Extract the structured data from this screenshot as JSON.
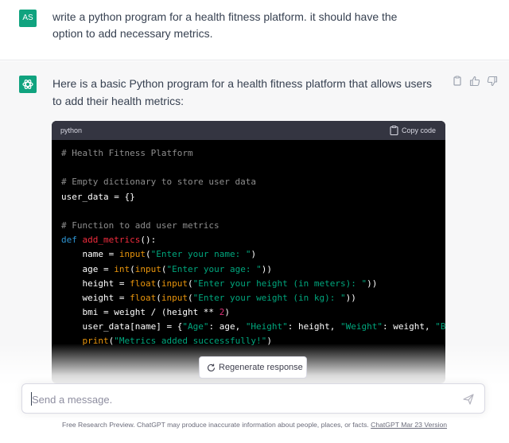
{
  "user_message": {
    "avatar_initials": "AS",
    "text": "write a python program for a health fitness platform. it should have the option to add necessary metrics."
  },
  "assistant_message": {
    "avatar_icon": "openai-logo-icon",
    "text": "Here is a basic Python program for a health fitness platform that allows users to add their health metrics:",
    "actions": [
      "copy-icon",
      "thumbs-up-icon",
      "thumbs-down-icon"
    ]
  },
  "code_block": {
    "language": "python",
    "copy_label": "Copy code",
    "lines": [
      [
        [
          "comment",
          "# Health Fitness Platform"
        ]
      ],
      [],
      [
        [
          "comment",
          "# Empty dictionary to store user data"
        ]
      ],
      [
        [
          "plain",
          "user_data = {}"
        ]
      ],
      [],
      [
        [
          "comment",
          "# Function to add user metrics"
        ]
      ],
      [
        [
          "keyword",
          "def "
        ],
        [
          "func",
          "add_metrics"
        ],
        [
          "plain",
          "():"
        ]
      ],
      [
        [
          "plain",
          "    name = "
        ],
        [
          "builtin",
          "input"
        ],
        [
          "plain",
          "("
        ],
        [
          "string",
          "\"Enter your name: \""
        ],
        [
          "plain",
          ")"
        ]
      ],
      [
        [
          "plain",
          "    age = "
        ],
        [
          "builtin",
          "int"
        ],
        [
          "plain",
          "("
        ],
        [
          "builtin",
          "input"
        ],
        [
          "plain",
          "("
        ],
        [
          "string",
          "\"Enter your age: \""
        ],
        [
          "plain",
          "))"
        ]
      ],
      [
        [
          "plain",
          "    height = "
        ],
        [
          "builtin",
          "float"
        ],
        [
          "plain",
          "("
        ],
        [
          "builtin",
          "input"
        ],
        [
          "plain",
          "("
        ],
        [
          "string",
          "\"Enter your height (in meters): \""
        ],
        [
          "plain",
          "))"
        ]
      ],
      [
        [
          "plain",
          "    weight = "
        ],
        [
          "builtin",
          "float"
        ],
        [
          "plain",
          "("
        ],
        [
          "builtin",
          "input"
        ],
        [
          "plain",
          "("
        ],
        [
          "string",
          "\"Enter your weight (in kg): \""
        ],
        [
          "plain",
          "))"
        ]
      ],
      [
        [
          "plain",
          "    bmi = weight / (height ** "
        ],
        [
          "number",
          "2"
        ],
        [
          "plain",
          ")"
        ]
      ],
      [
        [
          "plain",
          "    user_data[name] = {"
        ],
        [
          "string",
          "\"Age\""
        ],
        [
          "plain",
          ": age, "
        ],
        [
          "string",
          "\"Height\""
        ],
        [
          "plain",
          ": height, "
        ],
        [
          "string",
          "\"Weight\""
        ],
        [
          "plain",
          ": weight, "
        ],
        [
          "string",
          "\"BMI\""
        ]
      ],
      [
        [
          "plain",
          "    "
        ],
        [
          "builtin",
          "print"
        ],
        [
          "plain",
          "("
        ],
        [
          "string",
          "\"Metrics added successfully!\""
        ],
        [
          "plain",
          ")"
        ]
      ]
    ]
  },
  "regenerate_label": "Regenerate response",
  "composer": {
    "placeholder": "Send a message.",
    "value": ""
  },
  "footer": {
    "text": "Free Research Preview. ChatGPT may produce inaccurate information about people, places, or facts. ",
    "link_text": "ChatGPT Mar 23 Version"
  },
  "colors": {
    "accent": "#10a37f",
    "code_bg": "#000000",
    "code_header_bg": "#343541",
    "assistant_bg": "#f7f7f8"
  }
}
